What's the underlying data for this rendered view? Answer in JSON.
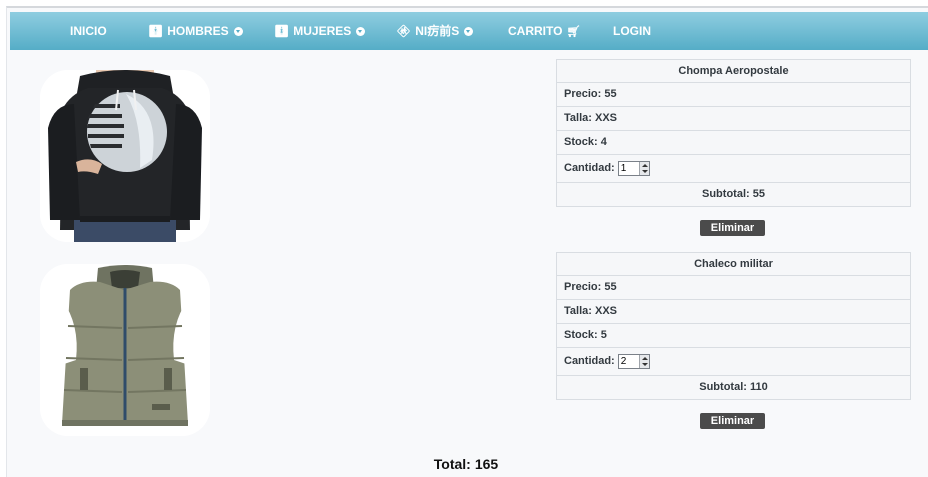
{
  "nav": {
    "items": [
      {
        "label": "INICIO",
        "icon": "",
        "dropdown": false
      },
      {
        "label": "HOMBRES",
        "icon": "man-icon",
        "dropdown": true
      },
      {
        "label": "MUJERES",
        "icon": "woman-icon",
        "dropdown": true
      },
      {
        "label": "NI疠前S",
        "icon": "child-icon",
        "dropdown": true
      },
      {
        "label": "CARRITO",
        "icon": "cart-icon",
        "dropdown": false
      },
      {
        "label": "LOGIN",
        "icon": "",
        "dropdown": false
      }
    ]
  },
  "cart": {
    "items": [
      {
        "name": "Chompa Aeropostale",
        "price_label": "Precio:",
        "price": "55",
        "size_label": "Talla:",
        "size": "XXS",
        "stock_label": "Stock:",
        "stock": "4",
        "qty_label": "Cantidad:",
        "qty": "1",
        "subtotal_label": "Subtotal:",
        "subtotal": "55",
        "delete_label": "Eliminar",
        "image": "hoodie-photo"
      },
      {
        "name": "Chaleco militar",
        "price_label": "Precio:",
        "price": "55",
        "size_label": "Talla:",
        "size": "XXS",
        "stock_label": "Stock:",
        "stock": "5",
        "qty_label": "Cantidad:",
        "qty": "2",
        "subtotal_label": "Subtotal:",
        "subtotal": "110",
        "delete_label": "Eliminar",
        "image": "vest-photo"
      }
    ],
    "total_label": "Total:",
    "total": "165"
  },
  "colors": {
    "nav_top": "#8fcde0",
    "nav_bottom": "#55adc7",
    "button": "#4b4b4b",
    "background": "#f8f9fb"
  }
}
